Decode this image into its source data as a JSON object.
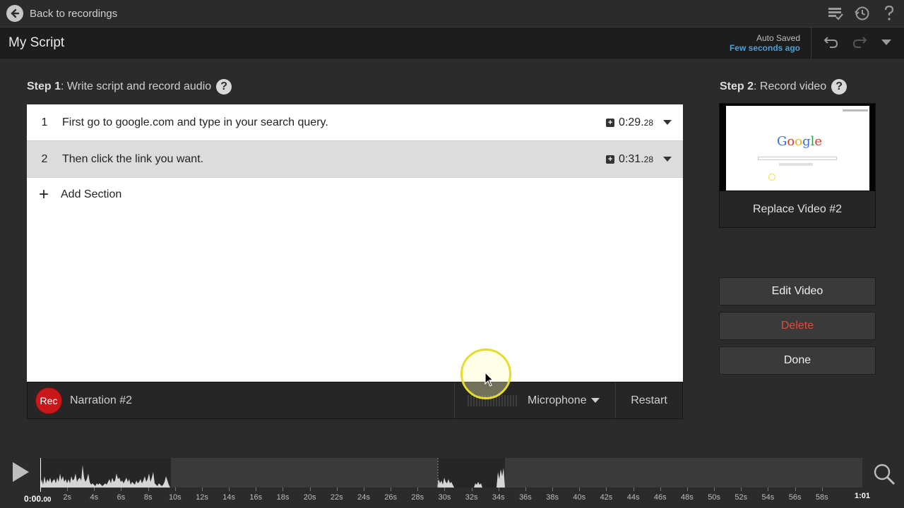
{
  "topbar": {
    "back_label": "Back to recordings",
    "icons": [
      "checklist-icon",
      "history-icon",
      "help-icon"
    ]
  },
  "titlebar": {
    "title": "My Script",
    "autosave_label": "Auto Saved",
    "autosave_time": "Few seconds ago"
  },
  "step1": {
    "label": "Step 1",
    "text": ": Write script and record audio"
  },
  "step2": {
    "label": "Step 2",
    "text": ": Record video"
  },
  "script": {
    "sections": [
      {
        "num": "1",
        "text": "First go to google.com and type in your search query.",
        "time": "0:29.",
        "time_ms": "28"
      },
      {
        "num": "2",
        "text": "Then click the link you want.",
        "time": "0:31.",
        "time_ms": "28"
      }
    ],
    "add_section_label": "Add Section"
  },
  "narration": {
    "rec_label": "Rec",
    "name": "Narration #2",
    "mic_label": "Microphone",
    "restart_label": "Restart"
  },
  "video": {
    "google_text": "Google",
    "replace_label": "Replace Video #2"
  },
  "actions": {
    "edit_label": "Edit Video",
    "delete_label": "Delete",
    "done_label": "Done"
  },
  "timeline": {
    "current_time": "0:00.",
    "current_ms": "00",
    "end_time": "1:01",
    "tick_labels": [
      "2s",
      "4s",
      "6s",
      "8s",
      "10s",
      "12s",
      "14s",
      "16s",
      "18s",
      "20s",
      "22s",
      "24s",
      "26s",
      "28s",
      "30s",
      "32s",
      "34s",
      "36s",
      "38s",
      "40s",
      "42s",
      "44s",
      "46s",
      "48s",
      "50s",
      "52s",
      "54s",
      "56s",
      "58s"
    ]
  },
  "colors": {
    "accent_blue": "#4d9fd8",
    "rec_red": "#c8181c",
    "delete_red": "#e24a3b"
  }
}
